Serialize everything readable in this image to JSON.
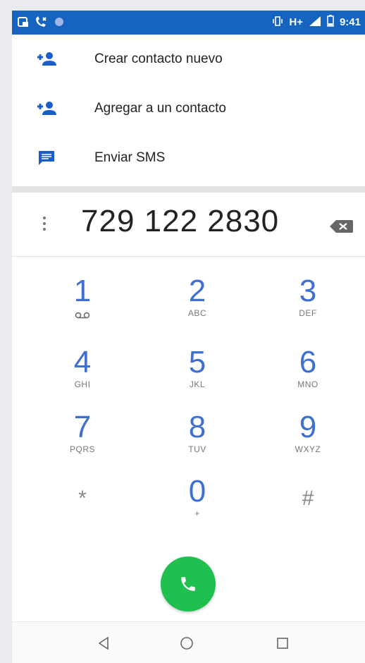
{
  "status_bar": {
    "time": "9:41",
    "network": "H+",
    "icons": [
      "screenshot-icon",
      "missed-call-icon",
      "notification-dot-icon",
      "vibrate-icon",
      "signal-icon",
      "battery-icon"
    ],
    "background_color": "#1565c0"
  },
  "menu": {
    "items": [
      {
        "label": "Crear contacto nuevo",
        "icon": "add-contact-icon"
      },
      {
        "label": "Agregar a un contacto",
        "icon": "add-contact-icon"
      },
      {
        "label": "Enviar SMS",
        "icon": "message-icon"
      }
    ],
    "icon_color": "#1a5fc9"
  },
  "dialer": {
    "number": "729 122 2830",
    "keys": [
      {
        "digit": "1",
        "letters": "ᴑᴑ"
      },
      {
        "digit": "2",
        "letters": "ABC"
      },
      {
        "digit": "3",
        "letters": "DEF"
      },
      {
        "digit": "4",
        "letters": "GHI"
      },
      {
        "digit": "5",
        "letters": "JKL"
      },
      {
        "digit": "6",
        "letters": "MNO"
      },
      {
        "digit": "7",
        "letters": "PQRS"
      },
      {
        "digit": "8",
        "letters": "TUV"
      },
      {
        "digit": "9",
        "letters": "WXYZ"
      },
      {
        "digit": "*",
        "letters": ""
      },
      {
        "digit": "0",
        "letters": "+"
      },
      {
        "digit": "#",
        "letters": ""
      }
    ],
    "digit_color": "#3e6fd1",
    "call_button_color": "#1fbf50"
  },
  "nav_bar": {
    "buttons": [
      "back-icon",
      "home-icon",
      "recents-icon"
    ]
  }
}
